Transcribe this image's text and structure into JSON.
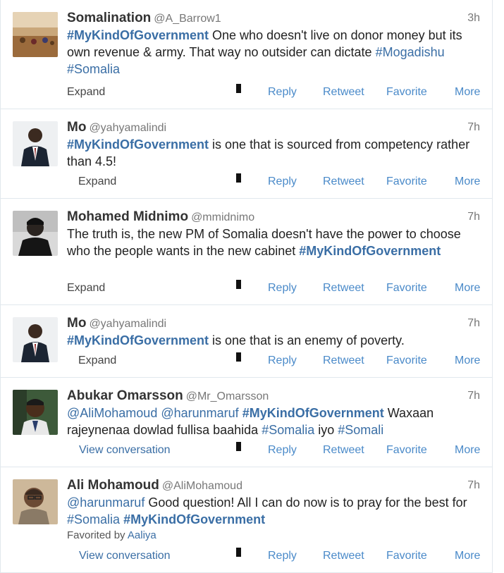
{
  "tweets": [
    {
      "name": "Somalination",
      "handle": "@A_Barrow1",
      "time": "3h",
      "segments": [
        {
          "t": "#MyKindOfGovernment",
          "k": "hb"
        },
        {
          "t": " One who doesn't live on donor money but its own revenue & army. That way no outsider can dictate ",
          "k": "p"
        },
        {
          "t": "#Mogadishu",
          "k": "h"
        },
        {
          "t": " ",
          "k": "p"
        },
        {
          "t": "#Somalia",
          "k": "h"
        }
      ],
      "expand_label": "Expand",
      "actions": {
        "reply": "Reply",
        "retweet": "Retweet",
        "favorite": "Favorite",
        "more": "More"
      }
    },
    {
      "name": "Mo",
      "handle": "@yahyamalindi",
      "time": "7h",
      "segments": [
        {
          "t": "#MyKindOfGovernment",
          "k": "hb"
        },
        {
          "t": " is one that is sourced from competency rather than 4.5!",
          "k": "p"
        }
      ],
      "expand_label": "Expand",
      "actions": {
        "reply": "Reply",
        "retweet": "Retweet",
        "favorite": "Favorite",
        "more": "More"
      }
    },
    {
      "name": "Mohamed Midnimo",
      "handle": "@mmidnimo",
      "time": "7h",
      "segments": [
        {
          "t": "The truth is, the new PM of Somalia doesn't have the power to choose who the people wants in the new cabinet ",
          "k": "p"
        },
        {
          "t": "#MyKindOfGovernment",
          "k": "hb"
        }
      ],
      "expand_label": "Expand",
      "actions": {
        "reply": "Reply",
        "retweet": "Retweet",
        "favorite": "Favorite",
        "more": "More"
      }
    },
    {
      "name": "Mo",
      "handle": "@yahyamalindi",
      "time": "7h",
      "segments": [
        {
          "t": "#MyKindOfGovernment",
          "k": "hb"
        },
        {
          "t": " is one that is an enemy of poverty.",
          "k": "p"
        }
      ],
      "expand_label": "Expand",
      "actions": {
        "reply": "Reply",
        "retweet": "Retweet",
        "favorite": "Favorite",
        "more": "More"
      }
    },
    {
      "name": "Abukar Omarsson",
      "handle": "@Mr_Omarsson",
      "time": "7h",
      "segments": [
        {
          "t": "@AliMohamoud",
          "k": "h"
        },
        {
          "t": " ",
          "k": "p"
        },
        {
          "t": "@harunmaruf",
          "k": "h"
        },
        {
          "t": " ",
          "k": "p"
        },
        {
          "t": "#MyKindOfGovernment",
          "k": "hb"
        },
        {
          "t": " Waxaan rajeynenaa dowlad fullisa baahida ",
          "k": "p"
        },
        {
          "t": "#Somalia",
          "k": "h"
        },
        {
          "t": " iyo ",
          "k": "p"
        },
        {
          "t": "#Somali",
          "k": "h"
        }
      ],
      "expand_label": "View conversation",
      "actions": {
        "reply": "Reply",
        "retweet": "Retweet",
        "favorite": "Favorite",
        "more": "More"
      }
    },
    {
      "name": "Ali Mohamoud",
      "handle": "@AliMohamoud",
      "time": "7h",
      "segments": [
        {
          "t": "@harunmaruf",
          "k": "h"
        },
        {
          "t": " Good question! All I can do now is to pray for the best for ",
          "k": "p"
        },
        {
          "t": "#Somalia",
          "k": "h"
        },
        {
          "t": " ",
          "k": "p"
        },
        {
          "t": "#MyKindOfGovernment",
          "k": "hb"
        }
      ],
      "favorited_prefix": "Favorited by",
      "favorited_user": "Aaliya",
      "expand_label": "View conversation",
      "actions": {
        "reply": "Reply",
        "retweet": "Retweet",
        "favorite": "Favorite",
        "more": "More"
      }
    }
  ]
}
